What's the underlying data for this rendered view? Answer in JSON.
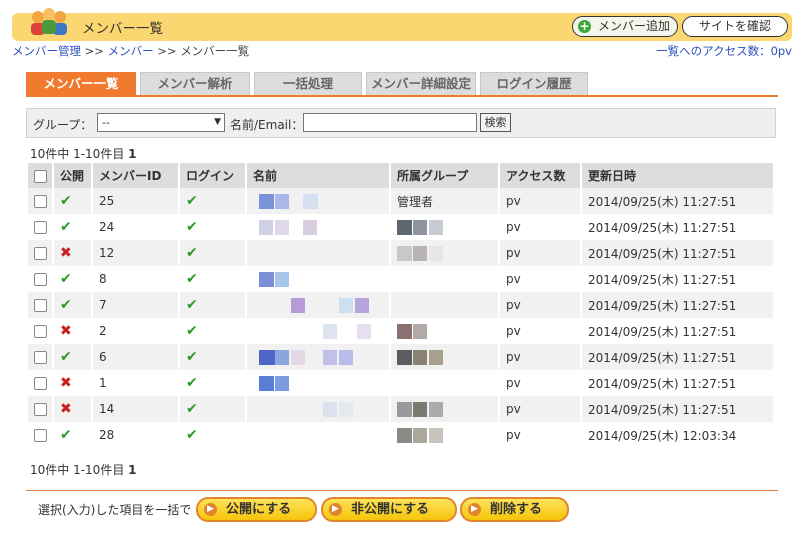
{
  "header": {
    "title": "メンバー一覧",
    "add_button": "メンバー追加",
    "site_button": "サイトを確認"
  },
  "breadcrumb": {
    "item1": "メンバー管理",
    "sep1": " >> ",
    "item2": "メンバー",
    "sep2": " >> ",
    "current": "メンバー一覧"
  },
  "access_link": "一覧へのアクセス数：0pv",
  "tabs": [
    "メンバー一覧",
    "メンバー解析",
    "一括処理",
    "メンバー詳細設定",
    "ログイン履歴"
  ],
  "filter": {
    "group_label": "グループ：",
    "group_value": "--",
    "name_label": "名前/Email：",
    "name_value": "",
    "search_button": "検索"
  },
  "summary": {
    "text": "10件中 1-10件目",
    "page": "1"
  },
  "table": {
    "headers": [
      "",
      "公開",
      "メンバーID",
      "ログイン",
      "名前",
      "所属グループ",
      "アクセス数",
      "更新日時"
    ],
    "rows": [
      {
        "public": true,
        "id": "25",
        "login": true,
        "group": "管理者",
        "access": "pv",
        "updated": "2014/09/25(木) 11:27:51"
      },
      {
        "public": true,
        "id": "24",
        "login": true,
        "group": "",
        "access": "pv",
        "updated": "2014/09/25(木) 11:27:51"
      },
      {
        "public": false,
        "id": "12",
        "login": true,
        "group": "",
        "access": "pv",
        "updated": "2014/09/25(木) 11:27:51"
      },
      {
        "public": true,
        "id": "8",
        "login": true,
        "group": "",
        "access": "pv",
        "updated": "2014/09/25(木) 11:27:51"
      },
      {
        "public": true,
        "id": "7",
        "login": true,
        "group": "",
        "access": "pv",
        "updated": "2014/09/25(木) 11:27:51"
      },
      {
        "public": false,
        "id": "2",
        "login": true,
        "group": "",
        "access": "pv",
        "updated": "2014/09/25(木) 11:27:51"
      },
      {
        "public": true,
        "id": "6",
        "login": true,
        "group": "",
        "access": "pv",
        "updated": "2014/09/25(木) 11:27:51"
      },
      {
        "public": false,
        "id": "1",
        "login": true,
        "group": "",
        "access": "pv",
        "updated": "2014/09/25(木) 11:27:51"
      },
      {
        "public": false,
        "id": "14",
        "login": true,
        "group": "",
        "access": "pv",
        "updated": "2014/09/25(木) 11:27:51"
      },
      {
        "public": true,
        "id": "28",
        "login": true,
        "group": "",
        "access": "pv",
        "updated": "2014/09/25(木) 12:03:34"
      }
    ]
  },
  "bulk": {
    "label": "選択(入力)した項目を一括で",
    "publish": "公開にする",
    "unpublish": "非公開にする",
    "delete": "削除する"
  },
  "colors": {
    "accent": "#f07a2e",
    "header_bg": "#fbd772",
    "ok": "#2a9a2a",
    "ng": "#cc2020"
  }
}
